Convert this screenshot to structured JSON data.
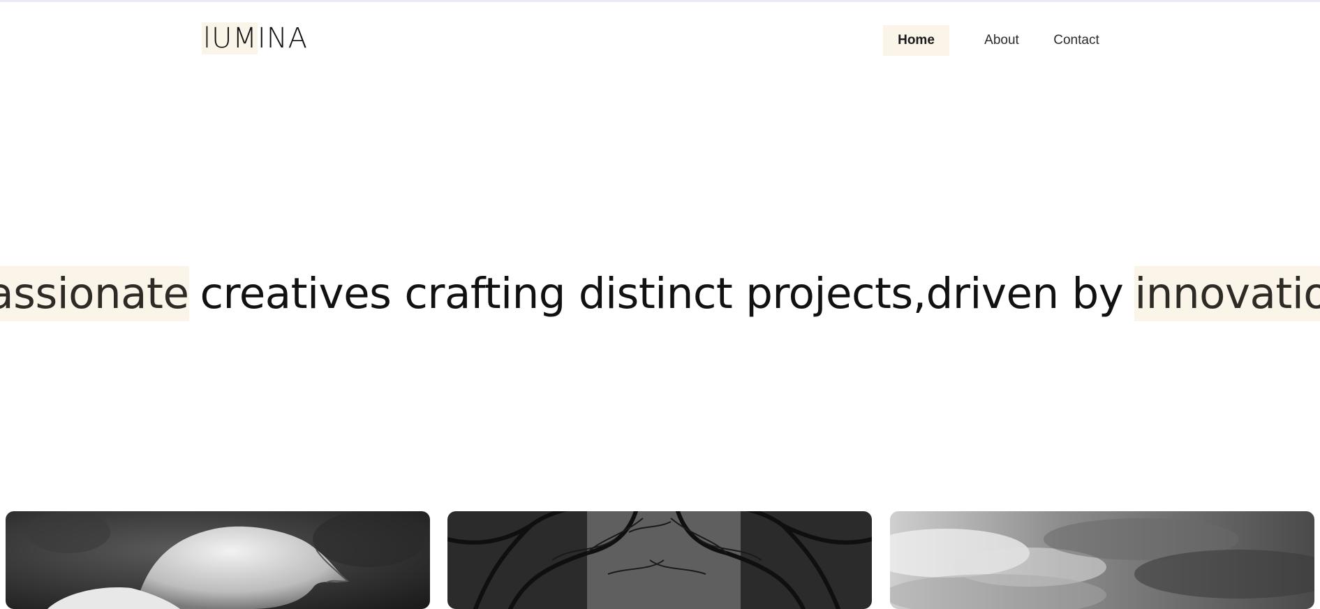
{
  "header": {
    "logo": {
      "highlighted": "lUM",
      "rest": "INA"
    },
    "nav": {
      "items": [
        {
          "label": "Home",
          "active": true
        },
        {
          "label": "About",
          "active": false
        },
        {
          "label": "Contact",
          "active": false
        }
      ]
    }
  },
  "hero": {
    "word_start": "Passionate",
    "middle": "creatives crafting distinct projects,driven by",
    "word_end": "innovation"
  },
  "gallery": {
    "cards": [
      {
        "subject": "mushroom-photo"
      },
      {
        "subject": "tree-branches-photo"
      },
      {
        "subject": "cloudy-sky-photo"
      }
    ]
  },
  "colors": {
    "highlight": "#fbf4e8",
    "text": "#111111",
    "top_line": "#eceaf4"
  }
}
